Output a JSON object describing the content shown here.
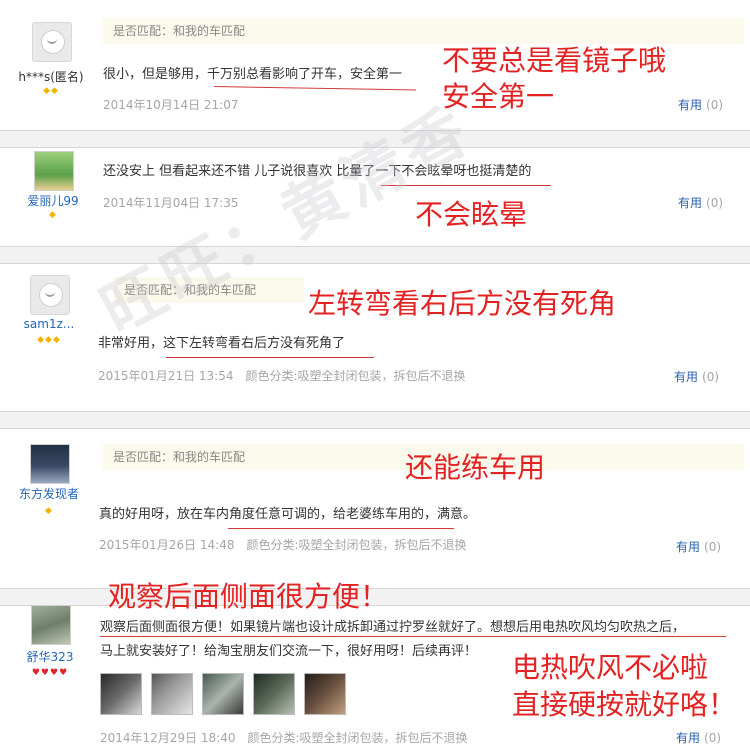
{
  "watermark": "旺旺：黄清香",
  "reviews": [
    {
      "user": "h***s(匿名)",
      "match": "是否匹配：和我的车匹配",
      "text": "很小，但是够用，千万别总看影响了开车，安全第一",
      "date": "2014年10月14日 21:07",
      "useful_label": "有用",
      "useful_count": "(0)",
      "annotation_lines": [
        "不要总是看镜子哦",
        "安全第一"
      ]
    },
    {
      "user": "爱丽儿99",
      "text": "还没安上 但看起来还不错 儿子说很喜欢 比量了一下不会眩晕呀也挺清楚的",
      "date": "2014年11月04日 17:35",
      "useful_label": "有用",
      "useful_count": "(0)",
      "annotation": "不会眩晕"
    },
    {
      "user": "sam1z...",
      "match": "是否匹配：和我的车匹配",
      "text": "非常好用，这下左转弯看右后方没有死角了",
      "date": "2015年01月21日 13:54",
      "attr": "颜色分类:吸塑全封闭包装，拆包后不退换",
      "useful_label": "有用",
      "useful_count": "(0)",
      "annotation": "左转弯看右后方没有死角"
    },
    {
      "user": "东方发现者",
      "match": "是否匹配：和我的车匹配",
      "text": "真的好用呀，放在车内角度任意可调的，给老婆练车用的，满意。",
      "date": "2015年01月26日 14:48",
      "attr": "颜色分类:吸塑全封闭包装，拆包后不退换",
      "useful_label": "有用",
      "useful_count": "(0)",
      "annotation": "还能练车用"
    },
    {
      "user": "舒华323",
      "text_line1": "观察后面侧面很方便！如果镜片端也设计成拆卸通过拧罗丝就好了。想想后用电热吹风均匀吹热之后，",
      "text_line2": "马上就安装好了！给淘宝朋友们交流一下，很好用呀！后续再评！",
      "date": "2014年12月29日 18:40",
      "attr": "颜色分类:吸塑全封闭包装，拆包后不退换",
      "useful_label": "有用",
      "useful_count": "(0)",
      "annotation_top": "观察后面侧面很方便！",
      "annotation_lines": [
        "电热吹风不必啦",
        "直接硬按就好咯！"
      ]
    }
  ]
}
